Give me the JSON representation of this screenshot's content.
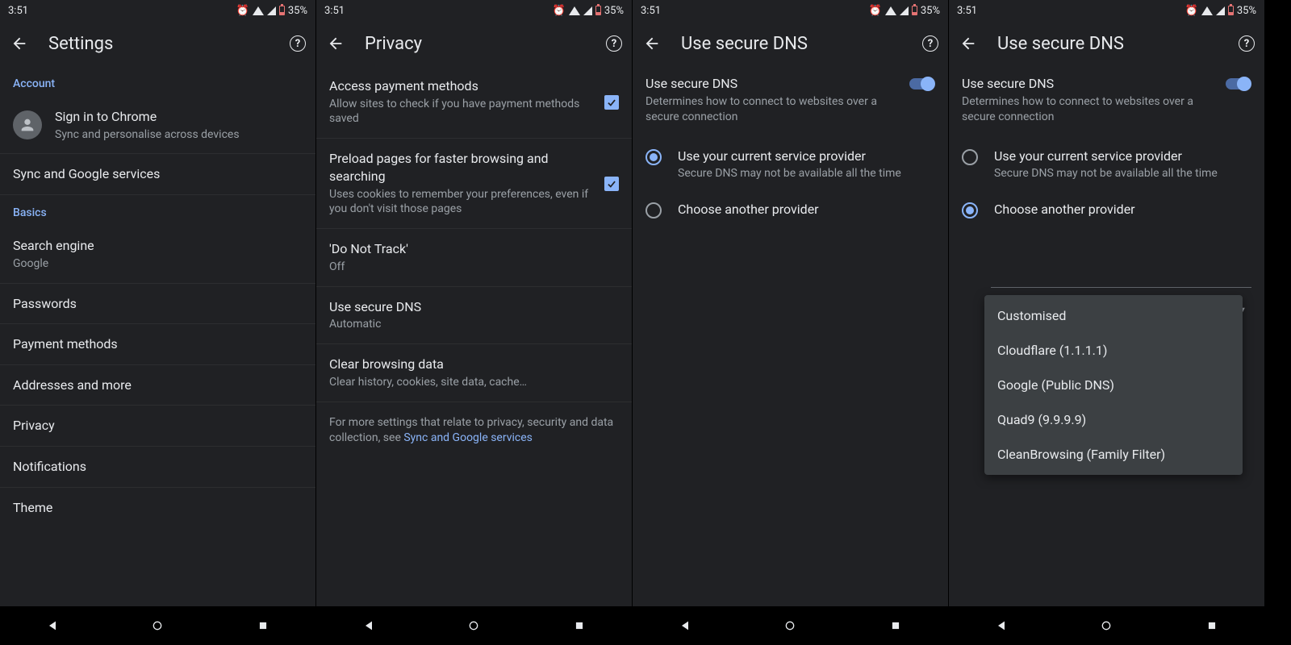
{
  "status": {
    "time": "3:51",
    "battery": "35%"
  },
  "screens": [
    {
      "title": "Settings",
      "section1": "Account",
      "signin": {
        "title": "Sign in to Chrome",
        "sub": "Sync and personalise across devices"
      },
      "sync": "Sync and Google services",
      "section2": "Basics",
      "items": [
        {
          "title": "Search engine",
          "sub": "Google"
        },
        {
          "title": "Passwords"
        },
        {
          "title": "Payment methods"
        },
        {
          "title": "Addresses and more"
        },
        {
          "title": "Privacy"
        },
        {
          "title": "Notifications"
        },
        {
          "title": "Theme"
        }
      ]
    },
    {
      "title": "Privacy",
      "rows": [
        {
          "title": "Access payment methods",
          "sub": "Allow sites to check if you have payment methods saved",
          "checked": true
        },
        {
          "title": "Preload pages for faster browsing and searching",
          "sub": "Uses cookies to remember your preferences, even if you don't visit those pages",
          "checked": true
        },
        {
          "title": "'Do Not Track'",
          "sub": "Off"
        },
        {
          "title": "Use secure DNS",
          "sub": "Automatic"
        },
        {
          "title": "Clear browsing data",
          "sub": "Clear history, cookies, site data, cache…"
        }
      ],
      "footer_pre": "For more settings that relate to privacy, security and data collection, see ",
      "footer_link": "Sync and Google services"
    },
    {
      "title": "Use secure DNS",
      "toggle": {
        "title": "Use secure DNS",
        "sub": "Determines how to connect to websites over a secure connection"
      },
      "radios": [
        {
          "title": "Use your current service provider",
          "sub": "Secure DNS may not be available all the time",
          "checked": true
        },
        {
          "title": "Choose another provider",
          "checked": false
        }
      ]
    },
    {
      "title": "Use secure DNS",
      "toggle": {
        "title": "Use secure DNS",
        "sub": "Determines how to connect to websites over a secure connection"
      },
      "radios": [
        {
          "title": "Use your current service provider",
          "sub": "Secure DNS may not be available all the time",
          "checked": false
        },
        {
          "title": "Choose another provider",
          "checked": true
        }
      ],
      "menu": [
        "Customised",
        "Cloudflare (1.1.1.1)",
        "Google (Public DNS)",
        "Quad9 (9.9.9.9)",
        "CleanBrowsing (Family Filter)"
      ]
    }
  ]
}
